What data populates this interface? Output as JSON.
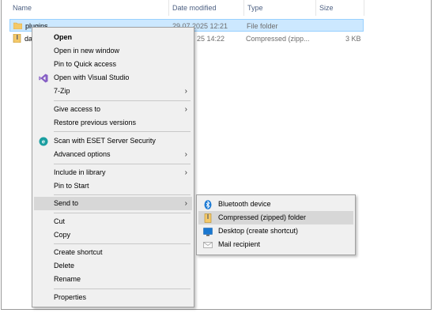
{
  "columns": {
    "name": "Name",
    "date_modified": "Date modified",
    "type": "Type",
    "size": "Size"
  },
  "files": [
    {
      "name": "plugins",
      "date": "29.07.2025 12:21",
      "type": "File folder",
      "size": ""
    },
    {
      "name": "da",
      "date": "25 14:22",
      "type": "Compressed (zipp...",
      "size": "3 KB"
    }
  ],
  "context_menu": {
    "open": "Open",
    "open_new_window": "Open in new window",
    "pin_quick_access": "Pin to Quick access",
    "open_visual_studio": "Open with Visual Studio",
    "seven_zip": "7-Zip",
    "give_access": "Give access to",
    "restore_versions": "Restore previous versions",
    "scan_eset": "Scan with ESET Server Security",
    "advanced_options": "Advanced options",
    "include_library": "Include in library",
    "pin_start": "Pin to Start",
    "send_to": "Send to",
    "cut": "Cut",
    "copy": "Copy",
    "create_shortcut": "Create shortcut",
    "delete": "Delete",
    "rename": "Rename",
    "properties": "Properties"
  },
  "send_to_menu": {
    "bluetooth": "Bluetooth device",
    "compressed": "Compressed (zipped) folder",
    "desktop": "Desktop (create shortcut)",
    "mail": "Mail recipient"
  },
  "colors": {
    "selection": "#cce8ff",
    "menu_bg": "#f0f0f0",
    "menu_highlight": "#d7d7d7",
    "header_text": "#4d6082",
    "vs_purple": "#865fc5",
    "eset_teal": "#1a9ea0",
    "bluetooth_blue": "#1c7ad4"
  }
}
